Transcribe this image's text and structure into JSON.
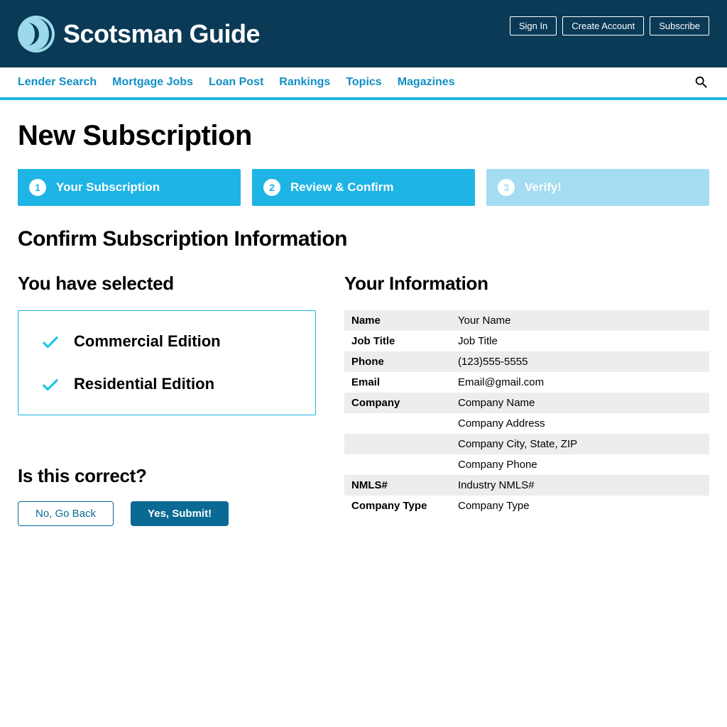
{
  "header": {
    "brand": "Scotsman Guide",
    "buttons": {
      "signin": "Sign In",
      "create": "Create Account",
      "subscribe": "Subscribe"
    }
  },
  "nav": {
    "items": [
      "Lender Search",
      "Mortgage Jobs",
      "Loan Post",
      "Rankings",
      "Topics",
      "Magazines"
    ]
  },
  "page": {
    "title": "New Subscription",
    "section_title": "Confirm Subscription Information"
  },
  "steps": [
    {
      "num": "1",
      "label": "Your Subscription",
      "active": true
    },
    {
      "num": "2",
      "label": "Review & Confirm",
      "active": true
    },
    {
      "num": "3",
      "label": "Verify!",
      "active": false
    }
  ],
  "selected": {
    "heading": "You have selected",
    "items": [
      "Commercial Edition",
      "Residential Edition"
    ]
  },
  "info": {
    "heading": "Your Information",
    "rows": [
      {
        "label": "Name",
        "value": "Your Name"
      },
      {
        "label": "Job Title",
        "value": "Job Title"
      },
      {
        "label": "Phone",
        "value": "(123)555-5555"
      },
      {
        "label": "Email",
        "value": "Email@gmail.com"
      },
      {
        "label": "Company",
        "value": "Company Name"
      },
      {
        "label": "",
        "value": "Company Address"
      },
      {
        "label": "",
        "value": "Company City, State, ZIP"
      },
      {
        "label": "",
        "value": "Company Phone"
      },
      {
        "label": "NMLS#",
        "value": "Industry NMLS#"
      },
      {
        "label": "Company Type",
        "value": "Company Type"
      }
    ]
  },
  "confirm": {
    "heading": "Is this correct?",
    "no": "No, Go Back",
    "yes": "Yes, Submit!"
  }
}
